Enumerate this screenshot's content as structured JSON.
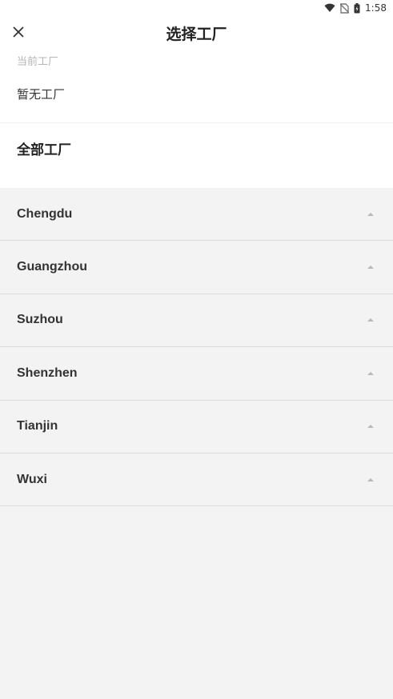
{
  "status_bar": {
    "time": "1:58",
    "icons": [
      "wifi-icon",
      "no-sim-icon",
      "battery-icon"
    ]
  },
  "header": {
    "title": "选择工厂",
    "close_icon": "close-icon"
  },
  "current_factory": {
    "label": "当前工厂",
    "value": "暂无工厂"
  },
  "all_factories": {
    "title": "全部工厂",
    "items": [
      {
        "label": "Chengdu",
        "icon": "chevron-up-icon"
      },
      {
        "label": "Guangzhou",
        "icon": "chevron-up-icon"
      },
      {
        "label": "Suzhou",
        "icon": "chevron-up-icon"
      },
      {
        "label": "Shenzhen",
        "icon": "chevron-up-icon"
      },
      {
        "label": "Tianjin",
        "icon": "chevron-up-icon"
      },
      {
        "label": "Wuxi",
        "icon": "chevron-up-icon"
      }
    ]
  },
  "colors": {
    "list_background": "#f3f3f3",
    "header_background": "#ffffff",
    "divider": "#dcdcdc"
  }
}
